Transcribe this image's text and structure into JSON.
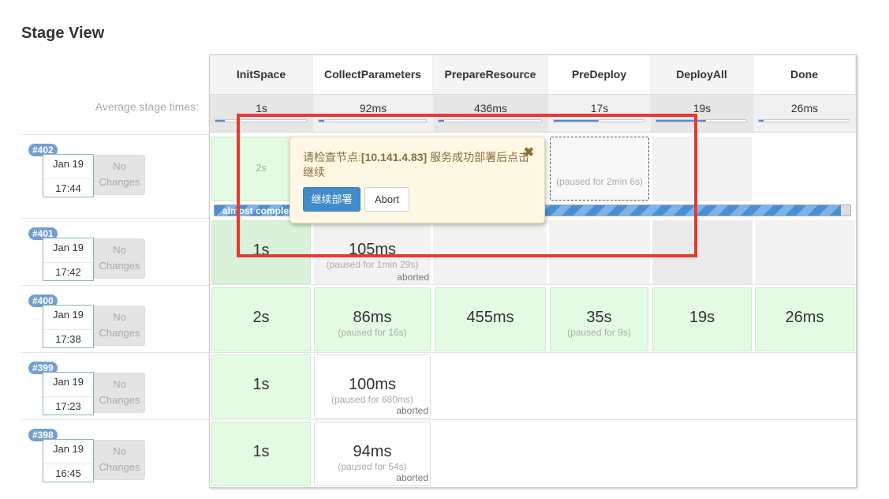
{
  "page": {
    "title": "Stage View",
    "avg_label": "Average stage times:"
  },
  "stages": [
    {
      "name": "InitSpace",
      "avg": "1s",
      "avg_fill": 0.1
    },
    {
      "name": "CollectParameters",
      "avg": "92ms",
      "avg_fill": 0.05
    },
    {
      "name": "PrepareResource",
      "avg": "436ms",
      "avg_fill": 0.05
    },
    {
      "name": "PreDeploy",
      "avg": "17s",
      "avg_fill": 0.5
    },
    {
      "name": "DeployAll",
      "avg": "19s",
      "avg_fill": 0.55
    },
    {
      "name": "Done",
      "avg": "26ms",
      "avg_fill": 0.05
    }
  ],
  "builds": [
    {
      "id": "#402",
      "date": "Jan 19",
      "time": "17:44",
      "changes": "No Changes",
      "cells": [
        {
          "dur": "2s"
        },
        {
          "dur": ""
        },
        {
          "dur": ""
        },
        {
          "pause": "(paused for 2min 6s)"
        },
        {
          "dur": ""
        },
        {
          "dur": ""
        }
      ]
    },
    {
      "id": "#401",
      "date": "Jan 19",
      "time": "17:42",
      "changes": "No Changes",
      "cells": [
        {
          "dur": "1s"
        },
        {
          "dur": "105ms",
          "pause": "(paused for 1min 29s)",
          "status": "aborted"
        },
        {},
        {},
        {},
        {}
      ]
    },
    {
      "id": "#400",
      "date": "Jan 19",
      "time": "17:38",
      "changes": "No Changes",
      "cells": [
        {
          "dur": "2s"
        },
        {
          "dur": "86ms",
          "pause": "(paused for 16s)"
        },
        {
          "dur": "455ms"
        },
        {
          "dur": "35s",
          "pause": "(paused for 9s)"
        },
        {
          "dur": "19s"
        },
        {
          "dur": "26ms"
        }
      ]
    },
    {
      "id": "#399",
      "date": "Jan 19",
      "time": "17:23",
      "changes": "No Changes",
      "cells": [
        {
          "dur": "1s"
        },
        {
          "dur": "100ms",
          "pause": "(paused for 680ms)",
          "status": "aborted"
        },
        {},
        {},
        {},
        {}
      ]
    },
    {
      "id": "#398",
      "date": "Jan 19",
      "time": "16:45",
      "changes": "No Changes",
      "cells": [
        {
          "dur": "1s"
        },
        {
          "dur": "94ms",
          "pause": "(paused for 54s)",
          "status": "aborted"
        },
        {},
        {},
        {},
        {}
      ]
    }
  ],
  "progress": {
    "label": "almost complete",
    "fraction": 0.985
  },
  "popup": {
    "msg_prefix": "请检查节点:",
    "msg_node": "[10.141.4.83]",
    "msg_suffix": " 服务成功部署后点击继续",
    "proceed": "继续部署",
    "abort": "Abort",
    "close_icon": "close-icon"
  },
  "colors": {
    "accent": "#428bca",
    "success_bg": "#e3fbe3",
    "highlight": "#e53935"
  }
}
